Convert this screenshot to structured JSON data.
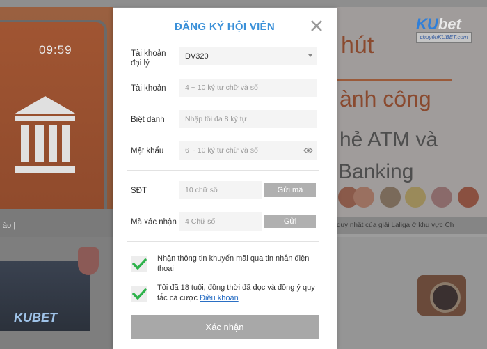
{
  "background": {
    "clock": "09:59",
    "left_footer": "ào  |",
    "logo_ku": "KU",
    "logo_bet": "bet",
    "logo_url": "chuyênKUBET.com",
    "headline_1": "hút",
    "headline_2": "ành công",
    "headline_3": "hẻ ATM và",
    "headline_4": "Banking",
    "ticker": "duy nhất của giải Laliga ở khu vực Ch",
    "lower_logo": "KUBET"
  },
  "modal": {
    "title": "ĐĂNG KÝ HỘI VIÊN",
    "fields": {
      "agent": {
        "label": "Tài khoản đại lý",
        "value": "DV320"
      },
      "account": {
        "label": "Tài khoản",
        "placeholder": "4 ~ 10 ký tự chữ và số"
      },
      "nickname": {
        "label": "Biệt danh",
        "placeholder": "Nhập tối đa 8 ký tự"
      },
      "password": {
        "label": "Mật khẩu",
        "placeholder": "6 ~ 10 ký tự chữ và số"
      },
      "phone": {
        "label": "SĐT",
        "placeholder": "10 chữ số",
        "button": "Gửi mã"
      },
      "code": {
        "label": "Mã xác nhận",
        "placeholder": "4 Chữ số",
        "button": "Gửi"
      }
    },
    "checks": {
      "promo": {
        "text": "Nhận thông tin khuyến mãi qua tin nhắn điện thoại",
        "checked": true
      },
      "terms": {
        "text": "Tôi đã 18 tuổi, đồng thời đã đọc và đồng ý quy tắc cá cược ",
        "link": "Điều khoản",
        "checked": true
      }
    },
    "submit": "Xác nhận"
  },
  "colors": {
    "accent": "#3a90d8",
    "check": "#2db24a",
    "button": "#a8a8a8"
  }
}
